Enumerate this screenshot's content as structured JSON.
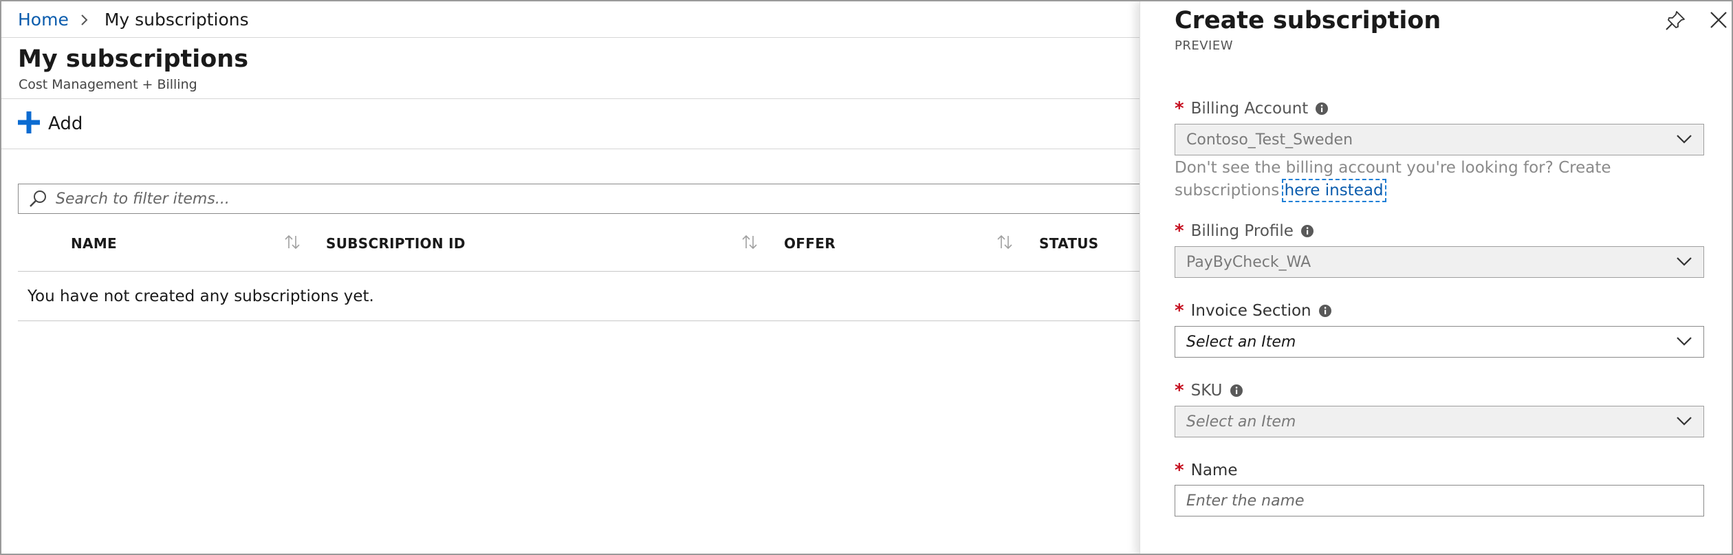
{
  "breadcrumb": {
    "home": "Home",
    "current": "My subscriptions"
  },
  "page": {
    "title": "My subscriptions",
    "subtitle": "Cost Management + Billing"
  },
  "toolbar": {
    "add_label": "Add"
  },
  "search": {
    "placeholder": "Search to filter items..."
  },
  "table": {
    "columns": [
      "NAME",
      "SUBSCRIPTION ID",
      "OFFER",
      "STATUS"
    ],
    "empty_message": "You have not created any subscriptions yet."
  },
  "blade": {
    "title": "Create subscription",
    "preview": "PREVIEW",
    "billing_account": {
      "label": "Billing Account",
      "value": "Contoso_Test_Sweden"
    },
    "helper_text": "Don't see the billing account you're looking for? Create subscriptions ",
    "helper_link": "here instead",
    "billing_profile": {
      "label": "Billing Profile",
      "value": "PayByCheck_WA"
    },
    "invoice_section": {
      "label": "Invoice Section",
      "value": "Select an Item"
    },
    "sku": {
      "label": "SKU",
      "value": "Select an Item"
    },
    "name": {
      "label": "Name",
      "placeholder": "Enter the name"
    },
    "required_marker": "*"
  },
  "colors": {
    "accent": "#0b5cad",
    "add_icon": "#0b6bd1",
    "required": "#c50f1f"
  },
  "icons": [
    "chevron-right-icon",
    "plus-icon",
    "search-icon",
    "sort-icon",
    "pin-icon",
    "close-icon",
    "info-icon",
    "chevron-down-icon"
  ]
}
